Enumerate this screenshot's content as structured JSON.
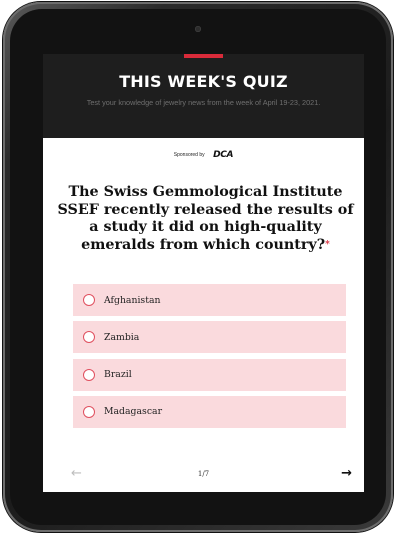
{
  "quiz": {
    "title": "THIS WEEK'S QUIZ",
    "subtitle": "Test your knowledge of jewelry news from the week of April 19-23, 2021.",
    "accent_color": "#d92b3a"
  },
  "sponsor": {
    "label": "Sponsored by",
    "logo_text": "DCA"
  },
  "question": {
    "text": "The Swiss Gemmological Institute SSEF recently released the results of a study it did on high-quality emeralds from which country?",
    "required_marker": "*"
  },
  "options": [
    {
      "label": "Afghanistan"
    },
    {
      "label": "Zambia"
    },
    {
      "label": "Brazil"
    },
    {
      "label": "Madagascar"
    }
  ],
  "pager": {
    "prev_icon": "←",
    "next_icon": "→",
    "position": "1/7"
  },
  "colors": {
    "option_background": "#fadadd",
    "radio_border": "#e0505f",
    "header_background": "#1e1e1e"
  }
}
